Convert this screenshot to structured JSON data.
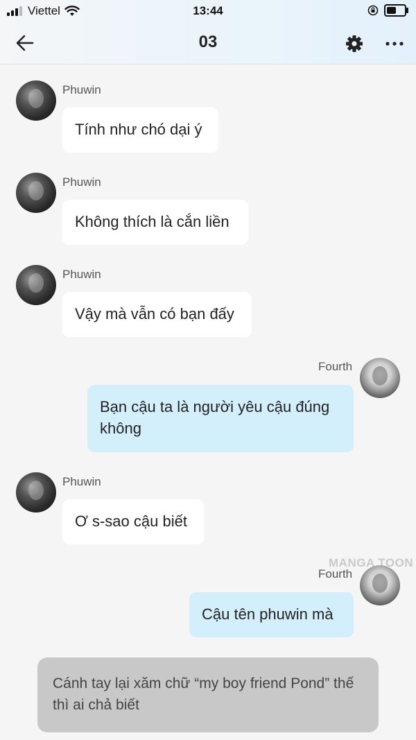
{
  "status_bar": {
    "carrier": "Viettel",
    "time": "13:44"
  },
  "header": {
    "title": "03"
  },
  "watermark": "MANGA TOON",
  "messages": [
    {
      "sender": "Phuwin",
      "text": "Tính như chó dại ý",
      "side": "left"
    },
    {
      "sender": "Phuwin",
      "text": "Không thích là cắn liền",
      "side": "left"
    },
    {
      "sender": "Phuwin",
      "text": "Vậy mà vẫn có bạn đấy",
      "side": "left"
    },
    {
      "sender": "Fourth",
      "text": "Bạn cậu ta là người yêu cậu đúng không",
      "side": "right"
    },
    {
      "sender": "Phuwin",
      "text": "Ơ s-sao cậu biết",
      "side": "left"
    },
    {
      "sender": "Fourth",
      "text": "Cậu tên phuwin mà",
      "side": "right"
    }
  ],
  "narration": "Cánh tay lại xăm chữ “my boy friend Pond” thế thì ai chả biết",
  "colors": {
    "incoming_bubble": "#ffffff",
    "outgoing_bubble": "#d3effc",
    "narration_bubble": "#c8c8c8",
    "background": "#f5f5f5"
  }
}
